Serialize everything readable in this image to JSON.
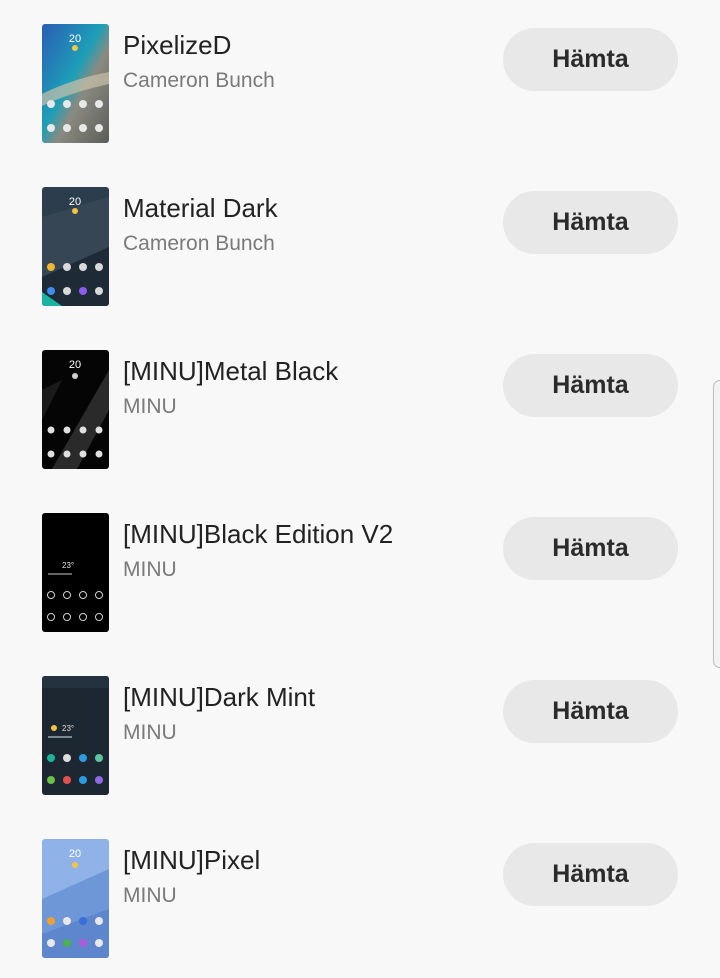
{
  "themes": [
    {
      "title": "PixelizeD",
      "author": "Cameron Bunch",
      "button": "Hämta",
      "clock": "20",
      "thumbnail_colors": [
        "#2d62b8",
        "#18a5b8",
        "#6d6f6a"
      ]
    },
    {
      "title": "Material Dark",
      "author": "Cameron Bunch",
      "button": "Hämta",
      "clock": "20",
      "thumbnail_colors": [
        "#2c3e4e",
        "#374655",
        "#1e2b36"
      ]
    },
    {
      "title": "[MINU]Metal Black",
      "author": "MINU",
      "button": "Hämta",
      "clock": "20",
      "thumbnail_colors": [
        "#050505",
        "#2a2a2a",
        "#0c0c0c"
      ]
    },
    {
      "title": "[MINU]Black Edition V2",
      "author": "MINU",
      "button": "Hämta",
      "clock": "23°",
      "thumbnail_colors": [
        "#000000",
        "#050505",
        "#000000"
      ]
    },
    {
      "title": "[MINU]Dark Mint",
      "author": "MINU",
      "button": "Hämta",
      "clock": "23°",
      "thumbnail_colors": [
        "#1c2732",
        "#1e2d3a",
        "#141d26"
      ]
    },
    {
      "title": "[MINU]Pixel",
      "author": "MINU",
      "button": "Hämta",
      "clock": "20",
      "thumbnail_colors": [
        "#8fb2e8",
        "#6e97d8",
        "#5d86cc"
      ]
    }
  ]
}
